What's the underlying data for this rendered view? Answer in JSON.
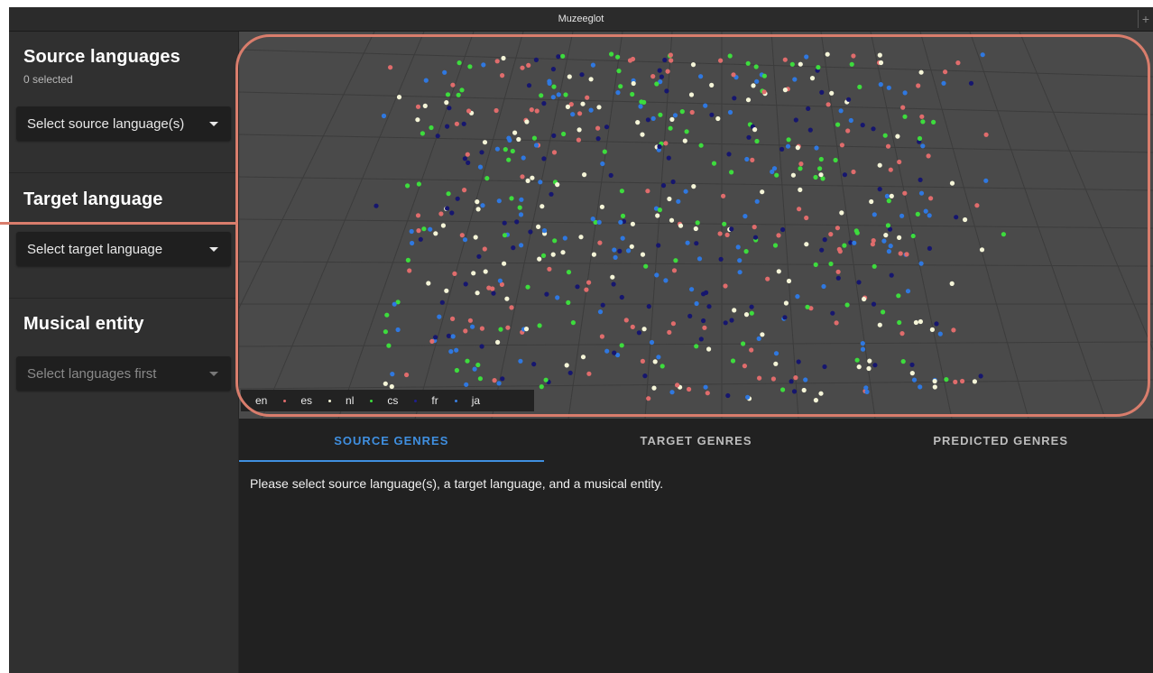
{
  "window": {
    "title": "Muzeeglot",
    "new_tab": "+"
  },
  "sidebar": {
    "source": {
      "heading": "Source languages",
      "count": "0 selected",
      "select_value": "Select source language(s)"
    },
    "target": {
      "heading": "Target language",
      "select_value": "Select target language"
    },
    "entity": {
      "heading": "Musical entity",
      "select_value": "Select languages first"
    }
  },
  "legend": [
    {
      "label": "en",
      "color": "#e06c6c"
    },
    {
      "label": "es",
      "color": "#f5f5d8"
    },
    {
      "label": "nl",
      "color": "#3ddc3d"
    },
    {
      "label": "cs",
      "color": "#1e1e8f"
    },
    {
      "label": "fr",
      "color": "#3a7fe0"
    },
    {
      "label": "ja",
      "color": "#4a4a4a"
    }
  ],
  "point_colors": [
    "#e06c6c",
    "#f5f5d8",
    "#3ddc3d",
    "#16166e",
    "#2f78e0"
  ],
  "tabs": [
    {
      "label": "SOURCE GENRES",
      "active": true
    },
    {
      "label": "TARGET GENRES",
      "active": false
    },
    {
      "label": "PREDICTED GENRES",
      "active": false
    }
  ],
  "content": {
    "message": "Please select source language(s), a target language, and a musical entity."
  }
}
